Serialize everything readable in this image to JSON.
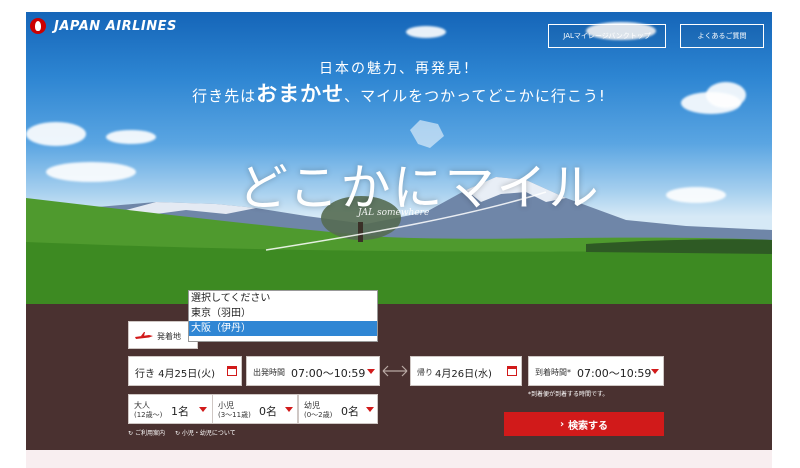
{
  "header": {
    "brand": "JAPAN AIRLINES",
    "mileage_bank_top": "JALマイレージバンクトップ",
    "faq": "よくあるご質問"
  },
  "hero": {
    "tagline_line1": "日本の魅力、再発見！",
    "tagline_line2_pre": "行き先は",
    "tagline_line2_big1": "おまかせ",
    "tagline_line2_mid": "、マイルをつかってどこかに行こう!",
    "title": "どこかにマイル",
    "subtitle": "JAL somewhere"
  },
  "search": {
    "departure_label": "発着地",
    "dropdown_options": [
      "選択してください",
      "東京（羽田）",
      "大阪（伊丹）"
    ],
    "dropdown_selected_index": 2,
    "outbound_date": "行き 4月25日(火)",
    "departure_time_label": "出発時間",
    "departure_time_value": "07:00〜10:59",
    "return_date_label": "帰り",
    "return_date_value": "4月26日(水)",
    "arrival_time_label": "到着時間*",
    "arrival_time_value": "07:00〜10:59",
    "arrival_note": "*到着便が到着する時間です。",
    "adult_label": "大人",
    "adult_age": "(12歳〜)",
    "adult_count": "1名",
    "child_label": "小児",
    "child_age": "(3〜11歳)",
    "child_count": "0名",
    "infant_label": "幼児",
    "infant_age": "(0〜2歳)",
    "infant_count": "0名",
    "search_button": "検索する",
    "link_guide": "ご利用案内",
    "link_child_infant": "小児・幼児について"
  },
  "colors": {
    "accent_red": "#d11a1a",
    "panel_brown": "#4a3130",
    "selected_blue": "#2f86d4"
  }
}
